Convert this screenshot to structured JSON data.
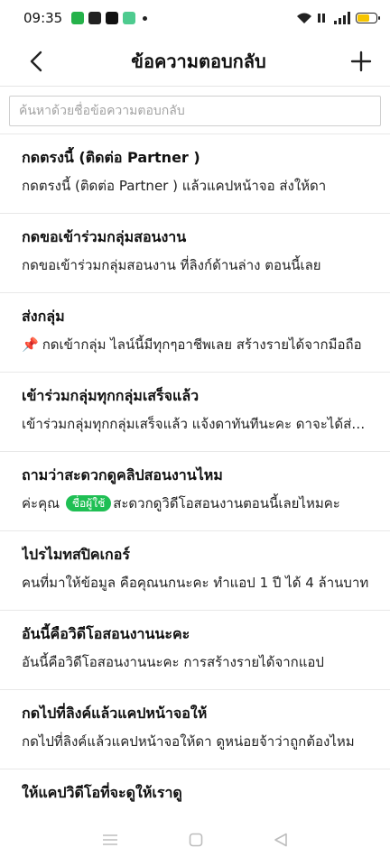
{
  "status": {
    "time": "09:35"
  },
  "header": {
    "title": "ข้อความตอบกลับ"
  },
  "search": {
    "placeholder": "ค้นหาด้วยชื่อข้อความตอบกลับ"
  },
  "items": [
    {
      "title": "กดตรงนี้ (ติดต่อ Partner )",
      "preview": "กดตรงนี้ (ติดต่อ Partner ) แล้วแคปหน้าจอ ส่งให้ดา"
    },
    {
      "title": "กดขอเข้าร่วมกลุ่มสอนงาน",
      "preview": "กดขอเข้าร่วมกลุ่มสอนงาน ที่ลิงก์ด้านล่าง ตอนนี้เลย"
    },
    {
      "title": "ส่งกลุ่ม",
      "preview": "กดเข้ากลุ่ม ไลน์นี้มีทุกๆอาชีพเลย สร้างรายได้จากมือถือ"
    },
    {
      "title": "เข้าร่วมกลุ่มทุกกลุ่มเสร็จแล้ว",
      "preview": "เข้าร่วมกลุ่มทุกกลุ่มเสร็จแล้ว แจ้งดาทันทีนะคะ ดาจะได้ส่งต่อ"
    },
    {
      "title": "ถามว่าสะดวกดูคลิปสอนงานไหม",
      "preview_before": "ค่ะคุณ",
      "tag": "ชื่อผู้ใช้",
      "preview_after": "สะดวกดูวิดีโอสอนงานตอนนี้เลยไหมคะ"
    },
    {
      "title": "ไปรไมทสปิคเกอร์",
      "preview": "คนที่มาให้ข้อมูล คือคุณนกนะคะ ทำแอป 1 ปี ได้ 4 ล้านบาท"
    },
    {
      "title": "อันนี้คือวิดีโอสอนงานนะคะ",
      "preview": "อันนี้คือวิดีโอสอนงานนะคะ การสร้างรายได้จากแอป"
    },
    {
      "title": "กดไปที่ลิงค์แล้วแคปหน้าจอให้",
      "preview": "กดไปที่ลิงค์แล้วแคปหน้าจอให้ดา ดูหน่อยจ้าว่าถูกต้องไหม"
    },
    {
      "title": "ให้แคปวิดีโอที่จะดูให้เราดู",
      "preview": ""
    }
  ],
  "icons": {
    "back": "chevron-left-icon",
    "add": "plus-icon",
    "nav": [
      "menu-icon",
      "home-square-icon",
      "back-triangle-icon"
    ]
  },
  "colors": {
    "accent": "#1fbf54",
    "pin": "#e53935"
  }
}
